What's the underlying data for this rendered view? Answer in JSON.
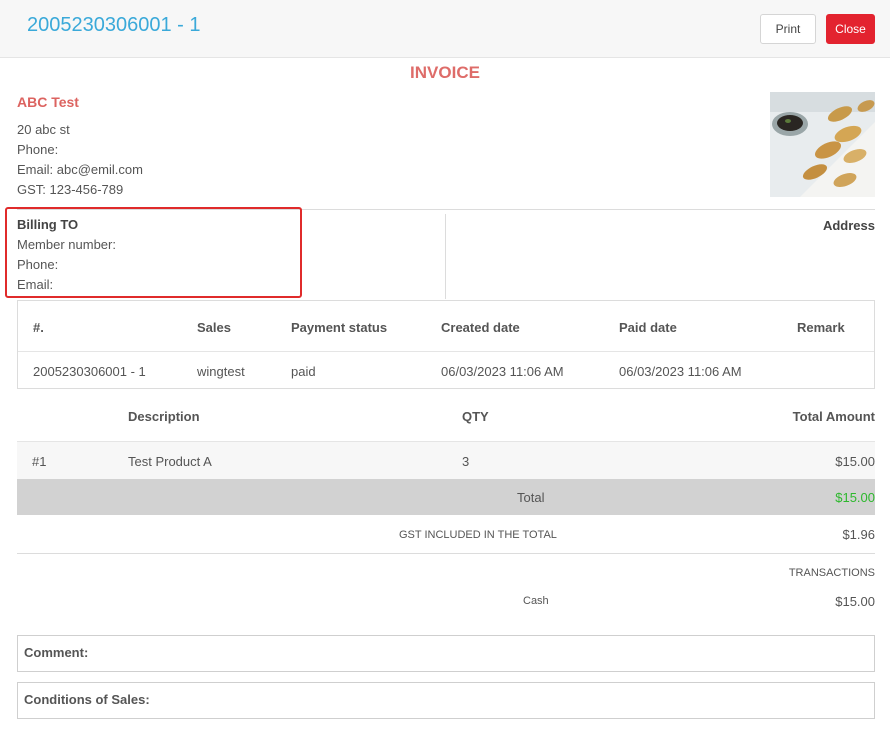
{
  "header": {
    "title": "2005230306001 - 1",
    "print_label": "Print",
    "close_label": "Close"
  },
  "invoice_title": "INVOICE",
  "company": {
    "name": "ABC Test",
    "lines": [
      "20 abc st",
      "Phone:",
      "Email: abc@emil.com",
      "GST: 123-456-789"
    ]
  },
  "billing": {
    "title": "Billing TO",
    "member": "Member number:",
    "phone": "Phone:",
    "email": "Email:",
    "address_label": "Address"
  },
  "info_table": {
    "headers": [
      "#.",
      "Sales",
      "Payment status",
      "Created date",
      "Paid date",
      "Remark"
    ],
    "row": [
      "2005230306001 - 1",
      "wingtest",
      "paid",
      "06/03/2023 11:06 AM",
      "06/03/2023 11:06 AM",
      ""
    ]
  },
  "items": {
    "headers": {
      "description": "Description",
      "qty": "QTY",
      "total": "Total Amount"
    },
    "rows": [
      {
        "no": "#1",
        "description": "Test Product A",
        "qty": "3",
        "amount": "$15.00"
      }
    ]
  },
  "totals": {
    "total_label": "Total",
    "total_value": "$15.00",
    "gst_label": "GST INCLUDED IN THE TOTAL",
    "gst_value": "$1.96",
    "transactions_label": "TRANSACTIONS",
    "cash_label": "Cash",
    "cash_value": "$15.00"
  },
  "comment_label": "Comment:",
  "conditions_label": "Conditions of Sales:",
  "colors": {
    "title_blue": "#3aa9d9",
    "close_red": "#e3232f",
    "invoice_red": "#d9534f",
    "total_green": "#2eb82e",
    "highlight_red": "#e02b2b"
  }
}
